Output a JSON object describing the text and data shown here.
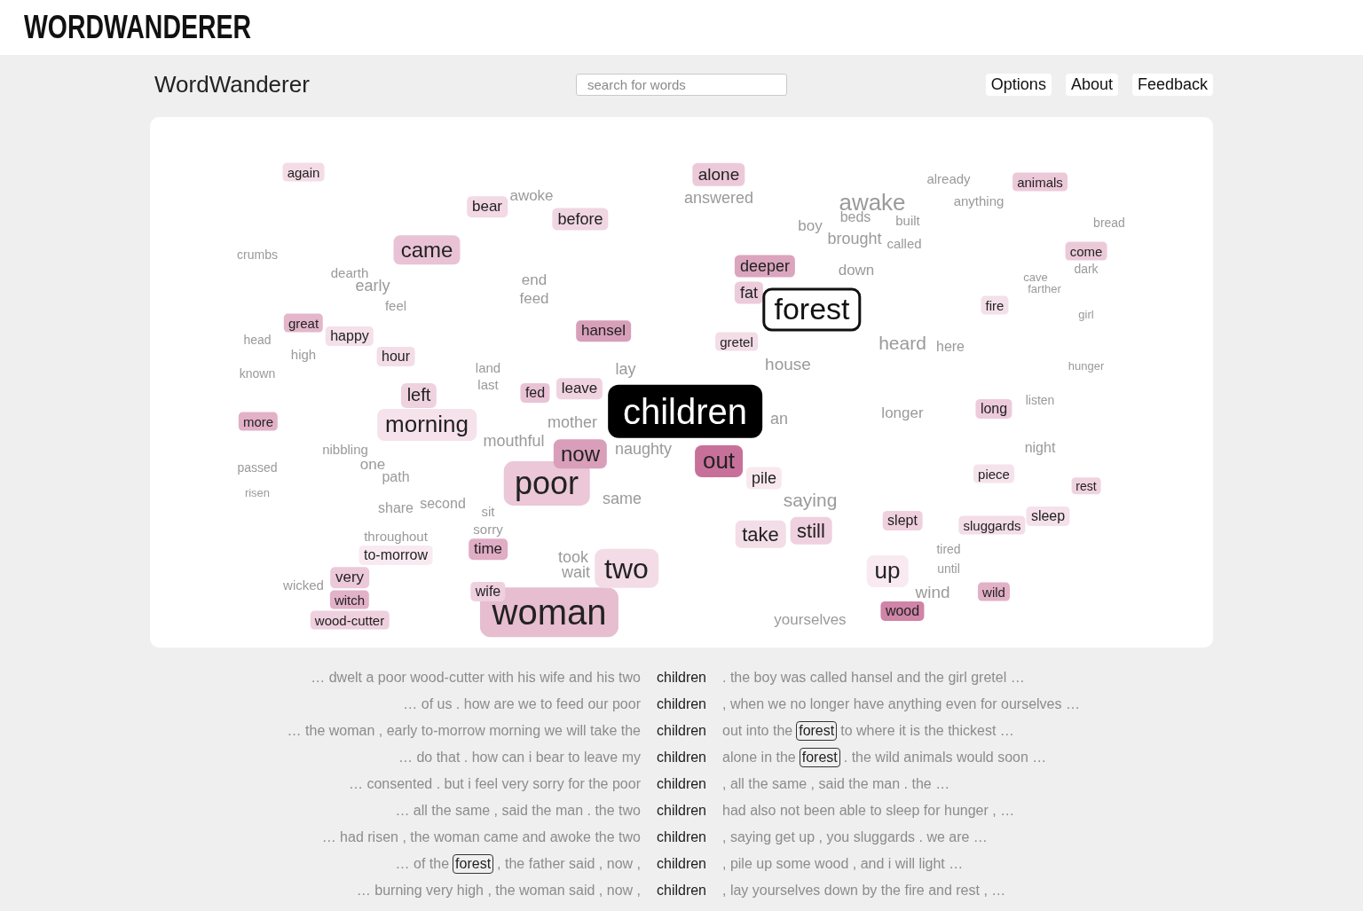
{
  "site_header": {
    "logo": "WORDWANDERER"
  },
  "toolbar": {
    "title": "WordWanderer",
    "search": {
      "placeholder": "search for words"
    },
    "nav": [
      "Options",
      "About",
      "Feedback"
    ]
  },
  "word_cloud": {
    "words": [
      {
        "text": "again",
        "kind": "tag",
        "color": "#f3dce6"
      },
      {
        "text": "alone",
        "kind": "tag",
        "color": "#ecc9d9"
      },
      {
        "text": "already",
        "kind": "faint"
      },
      {
        "text": "animals",
        "kind": "tag",
        "color": "#ecc9d9"
      },
      {
        "text": "bear",
        "kind": "tag",
        "color": "#f2d9e4"
      },
      {
        "text": "awoke",
        "kind": "faint"
      },
      {
        "text": "answered",
        "kind": "faint"
      },
      {
        "text": "before",
        "kind": "tag",
        "color": "#f0d6e2"
      },
      {
        "text": "awake",
        "kind": "faint"
      },
      {
        "text": "anything",
        "kind": "faint"
      },
      {
        "text": "boy",
        "kind": "faint"
      },
      {
        "text": "beds",
        "kind": "faint"
      },
      {
        "text": "built",
        "kind": "faint"
      },
      {
        "text": "bread",
        "kind": "faint"
      },
      {
        "text": "crumbs",
        "kind": "faint"
      },
      {
        "text": "came",
        "kind": "tag",
        "color": "#e9c3d5"
      },
      {
        "text": "brought",
        "kind": "faint"
      },
      {
        "text": "called",
        "kind": "faint"
      },
      {
        "text": "come",
        "kind": "tag",
        "color": "#ecc9d9"
      },
      {
        "text": "dearth",
        "kind": "faint"
      },
      {
        "text": "deeper",
        "kind": "tag",
        "color": "#dba5be"
      },
      {
        "text": "down",
        "kind": "faint"
      },
      {
        "text": "dark",
        "kind": "faint"
      },
      {
        "text": "early",
        "kind": "faint"
      },
      {
        "text": "end",
        "kind": "faint"
      },
      {
        "text": "cave",
        "kind": "faint"
      },
      {
        "text": "farther",
        "kind": "faint"
      },
      {
        "text": "feel",
        "kind": "faint"
      },
      {
        "text": "feed",
        "kind": "faint"
      },
      {
        "text": "fat",
        "kind": "tag",
        "color": "#eccbda"
      },
      {
        "text": "forest",
        "kind": "match"
      },
      {
        "text": "fire",
        "kind": "tag",
        "color": "#f4e0e9"
      },
      {
        "text": "girl",
        "kind": "faint"
      },
      {
        "text": "great",
        "kind": "tag",
        "color": "#e4b6cb"
      },
      {
        "text": "head",
        "kind": "faint"
      },
      {
        "text": "happy",
        "kind": "tag",
        "color": "#f4e0e9"
      },
      {
        "text": "hansel",
        "kind": "tag",
        "color": "#d89fb9"
      },
      {
        "text": "high",
        "kind": "faint"
      },
      {
        "text": "hour",
        "kind": "tag",
        "color": "#f3dde7"
      },
      {
        "text": "gretel",
        "kind": "tag",
        "color": "#f3dde7"
      },
      {
        "text": "heard",
        "kind": "faint"
      },
      {
        "text": "here",
        "kind": "faint"
      },
      {
        "text": "known",
        "kind": "faint"
      },
      {
        "text": "land",
        "kind": "faint"
      },
      {
        "text": "lay",
        "kind": "faint"
      },
      {
        "text": "house",
        "kind": "faint"
      },
      {
        "text": "hunger",
        "kind": "faint"
      },
      {
        "text": "left",
        "kind": "tag",
        "color": "#efd2df"
      },
      {
        "text": "last",
        "kind": "faint"
      },
      {
        "text": "fed",
        "kind": "tag",
        "color": "#e9c3d5"
      },
      {
        "text": "leave",
        "kind": "tag",
        "color": "#f0d3e0"
      },
      {
        "text": "more",
        "kind": "tag",
        "color": "#e2b1c7"
      },
      {
        "text": "morning",
        "kind": "tag",
        "color": "#f5e2ea"
      },
      {
        "text": "mother",
        "kind": "faint"
      },
      {
        "text": "nibbling",
        "kind": "faint"
      },
      {
        "text": "mouthful",
        "kind": "faint"
      },
      {
        "text": "children",
        "kind": "focus"
      },
      {
        "text": "an",
        "kind": "faint"
      },
      {
        "text": "longer",
        "kind": "faint"
      },
      {
        "text": "long",
        "kind": "tag",
        "color": "#edcbdb"
      },
      {
        "text": "listen",
        "kind": "faint"
      },
      {
        "text": "now",
        "kind": "tag",
        "color": "#d99fba"
      },
      {
        "text": "naughty",
        "kind": "faint"
      },
      {
        "text": "night",
        "kind": "faint"
      },
      {
        "text": "passed",
        "kind": "faint"
      },
      {
        "text": "one",
        "kind": "faint"
      },
      {
        "text": "path",
        "kind": "faint"
      },
      {
        "text": "risen",
        "kind": "faint"
      },
      {
        "text": "share",
        "kind": "faint"
      },
      {
        "text": "second",
        "kind": "faint"
      },
      {
        "text": "sit",
        "kind": "faint"
      },
      {
        "text": "poor",
        "kind": "tag",
        "color": "#ebc7d7"
      },
      {
        "text": "out",
        "kind": "tag",
        "color": "#c7719a"
      },
      {
        "text": "pile",
        "kind": "tag",
        "color": "#f8e9ef"
      },
      {
        "text": "piece",
        "kind": "tag",
        "color": "#f5e3eb"
      },
      {
        "text": "same",
        "kind": "faint"
      },
      {
        "text": "saying",
        "kind": "faint"
      },
      {
        "text": "rest",
        "kind": "tag",
        "color": "#f0d3e0"
      },
      {
        "text": "throughout",
        "kind": "faint"
      },
      {
        "text": "sorry",
        "kind": "faint"
      },
      {
        "text": "take",
        "kind": "tag",
        "color": "#f3dde7"
      },
      {
        "text": "still",
        "kind": "tag",
        "color": "#efd0de"
      },
      {
        "text": "slept",
        "kind": "tag",
        "color": "#efd0de"
      },
      {
        "text": "sluggards",
        "kind": "tag",
        "color": "#f3dde7"
      },
      {
        "text": "sleep",
        "kind": "tag",
        "color": "#f4e1ea"
      },
      {
        "text": "to-morrow",
        "kind": "tag",
        "color": "#f8eaf0"
      },
      {
        "text": "time",
        "kind": "tag",
        "color": "#e0adc4"
      },
      {
        "text": "took",
        "kind": "faint"
      },
      {
        "text": "wicked",
        "kind": "faint"
      },
      {
        "text": "very",
        "kind": "tag",
        "color": "#ecc9d9"
      },
      {
        "text": "wait",
        "kind": "faint"
      },
      {
        "text": "two",
        "kind": "tag",
        "color": "#f3dce6"
      },
      {
        "text": "tired",
        "kind": "faint"
      },
      {
        "text": "up",
        "kind": "tag",
        "color": "#f8eaf0"
      },
      {
        "text": "until",
        "kind": "faint"
      },
      {
        "text": "witch",
        "kind": "tag",
        "color": "#e2b2c8"
      },
      {
        "text": "wife",
        "kind": "tag",
        "color": "#efd0de"
      },
      {
        "text": "wood-cutter",
        "kind": "tag",
        "color": "#efd0de"
      },
      {
        "text": "woman",
        "kind": "tag",
        "color": "#e7bdd0"
      },
      {
        "text": "wind",
        "kind": "faint"
      },
      {
        "text": "wild",
        "kind": "tag",
        "color": "#e2b1c7"
      },
      {
        "text": "yourselves",
        "kind": "faint"
      },
      {
        "text": "wood",
        "kind": "tag",
        "color": "#cf84a8"
      }
    ]
  },
  "concordance": {
    "rows": [
      {
        "left": [
          {
            "text": "… dwelt a poor wood-cutter with his wife and his two",
            "kind": "plain"
          }
        ],
        "keyword": "children",
        "right": [
          {
            "text": ". the boy was called hansel and the girl gretel …",
            "kind": "plain"
          }
        ]
      },
      {
        "left": [
          {
            "text": "… of us . how are we to feed our poor",
            "kind": "plain"
          }
        ],
        "keyword": "children",
        "right": [
          {
            "text": ", when we no longer have anything even for ourselves …",
            "kind": "plain"
          }
        ]
      },
      {
        "left": [
          {
            "text": "… the woman , early to-morrow morning we will take the",
            "kind": "plain"
          }
        ],
        "keyword": "children",
        "right": [
          {
            "text": "out into the",
            "kind": "plain"
          },
          {
            "text": "forest",
            "kind": "match"
          },
          {
            "text": "to where it is the thickest …",
            "kind": "plain"
          }
        ]
      },
      {
        "left": [
          {
            "text": "… do that . how can i bear to leave my",
            "kind": "plain"
          }
        ],
        "keyword": "children",
        "right": [
          {
            "text": "alone in the",
            "kind": "plain"
          },
          {
            "text": "forest",
            "kind": "match"
          },
          {
            "text": ". the wild animals would soon …",
            "kind": "plain"
          }
        ]
      },
      {
        "left": [
          {
            "text": "… consented . but i feel very sorry for the poor",
            "kind": "plain"
          }
        ],
        "keyword": "children",
        "right": [
          {
            "text": ", all the same , said the man . the …",
            "kind": "plain"
          }
        ]
      },
      {
        "left": [
          {
            "text": "… all the same , said the man . the two",
            "kind": "plain"
          }
        ],
        "keyword": "children",
        "right": [
          {
            "text": "had also not been able to sleep for hunger , …",
            "kind": "plain"
          }
        ]
      },
      {
        "left": [
          {
            "text": "… had risen , the woman came and awoke the two",
            "kind": "plain"
          }
        ],
        "keyword": "children",
        "right": [
          {
            "text": ", saying get up , you sluggards . we are …",
            "kind": "plain"
          }
        ]
      },
      {
        "left": [
          {
            "text": "… of the",
            "kind": "plain"
          },
          {
            "text": "forest",
            "kind": "match"
          },
          {
            "text": ", the father said , now ,",
            "kind": "plain"
          }
        ],
        "keyword": "children",
        "right": [
          {
            "text": ", pile up some wood , and i will light …",
            "kind": "plain"
          }
        ]
      },
      {
        "left": [
          {
            "text": "… burning very high , the woman said , now ,",
            "kind": "plain"
          }
        ],
        "keyword": "children",
        "right": [
          {
            "text": ", lay yourselves down by the fire and rest , …",
            "kind": "plain"
          }
        ]
      }
    ]
  }
}
